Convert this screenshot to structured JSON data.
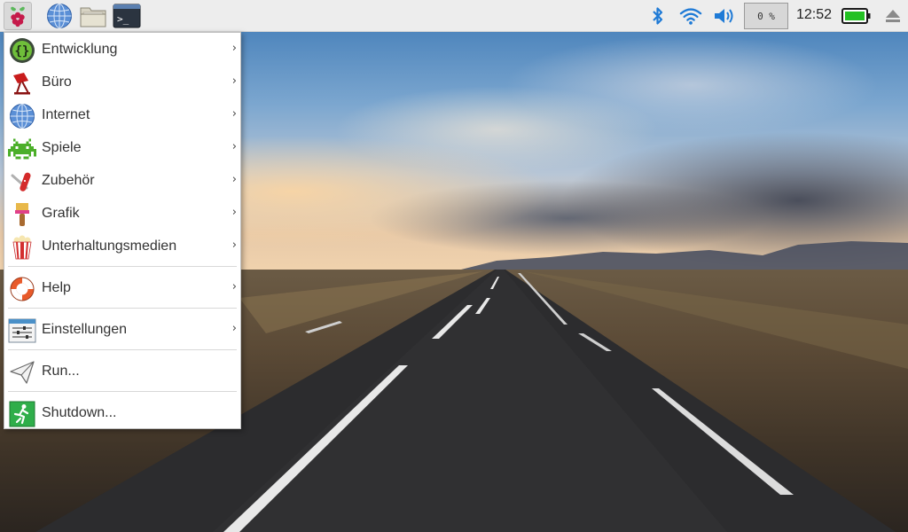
{
  "panel": {
    "launchers": [
      {
        "name": "raspberry-menu",
        "icon": "raspberry-icon"
      },
      {
        "name": "web-browser",
        "icon": "globe-icon"
      },
      {
        "name": "file-manager",
        "icon": "folder-icon"
      },
      {
        "name": "terminal",
        "icon": "terminal-icon",
        "glyph": ">_"
      }
    ],
    "tray": {
      "cpu": "0 %",
      "clock": "12:52"
    }
  },
  "menu": {
    "items": [
      {
        "label": "Entwicklung",
        "icon": "programming-icon",
        "submenu": true
      },
      {
        "label": "Büro",
        "icon": "office-icon",
        "submenu": true
      },
      {
        "label": "Internet",
        "icon": "globe-icon",
        "submenu": true
      },
      {
        "label": "Spiele",
        "icon": "space-invader-icon",
        "submenu": true
      },
      {
        "label": "Zubehör",
        "icon": "swiss-knife-icon",
        "submenu": true
      },
      {
        "label": "Grafik",
        "icon": "paintbrush-icon",
        "submenu": true
      },
      {
        "label": "Unterhaltungsmedien",
        "icon": "popcorn-icon",
        "submenu": true
      },
      {
        "label": "Help",
        "icon": "lifebuoy-icon",
        "submenu": true
      },
      {
        "label": "Einstellungen",
        "icon": "settings-sliders-icon",
        "submenu": true
      },
      {
        "label": "Run...",
        "icon": "paper-plane-icon",
        "submenu": false
      },
      {
        "label": "Shutdown...",
        "icon": "exit-icon",
        "submenu": false
      }
    ],
    "arrow": "›"
  },
  "colors": {
    "panel_bg": "#ededed",
    "menu_bg": "#ffffff",
    "battery_green": "#22c022",
    "accent_blue": "#1e7ad6"
  }
}
